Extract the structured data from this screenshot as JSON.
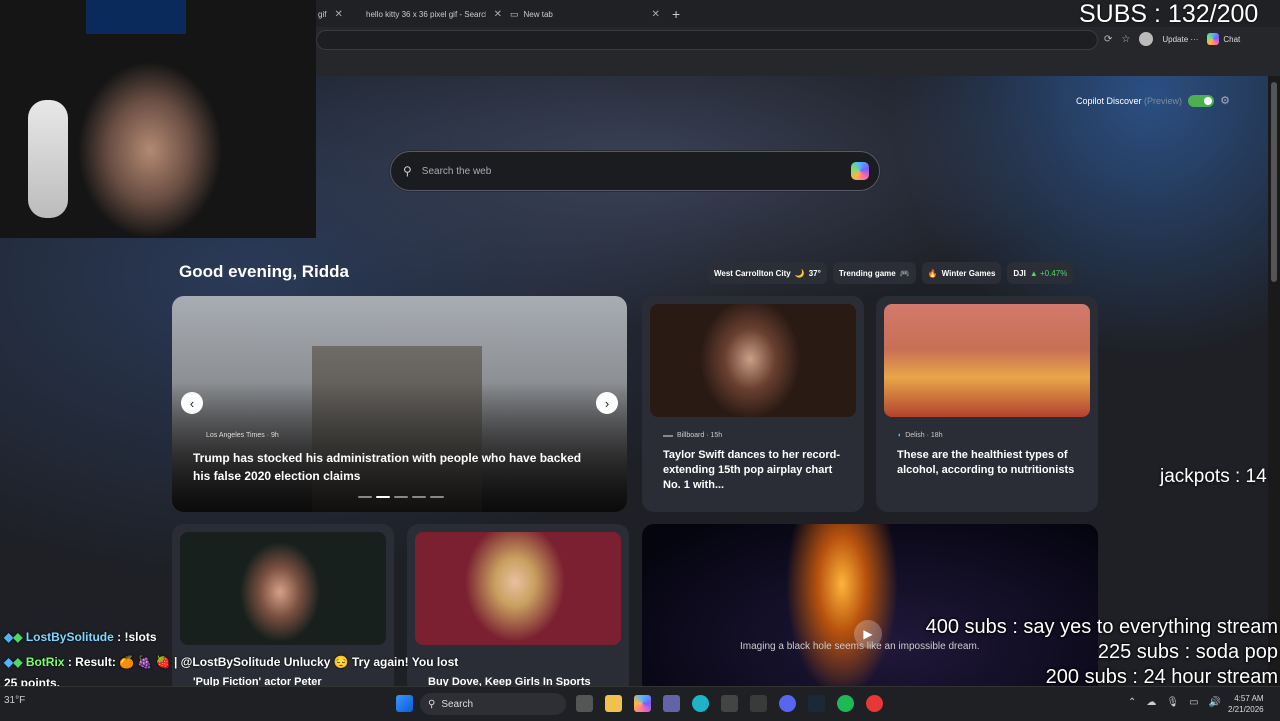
{
  "browser": {
    "tabs": [
      {
        "label": "gif",
        "active": false
      },
      {
        "label": "hello kitty 36 x 36 pixel gif - Search",
        "active": false
      },
      {
        "label": "New tab",
        "active": true
      }
    ],
    "update_label": "Update",
    "chat_label": "Chat"
  },
  "newtab": {
    "copilot_discover_label": "Copilot Discover",
    "preview_label": "(Preview)",
    "search_placeholder": "Search the web",
    "greeting": "Good evening, Ridda",
    "pills": [
      {
        "label": "West Carrollton City",
        "extra": "37°"
      },
      {
        "label": "Trending game",
        "extra": ""
      },
      {
        "label": "Winter Games",
        "extra": ""
      },
      {
        "label": "DJI",
        "extra": "▲ +0.47%"
      }
    ],
    "hero": {
      "source": "Los Angeles Times · 9h",
      "headline": "Trump has stocked his administration with people who have backed his false 2020 election claims"
    },
    "cards": [
      {
        "source": "Billboard · 15h",
        "headline": "Taylor Swift dances to her record-extending 15th pop airplay chart No. 1 with..."
      },
      {
        "source": "Delish · 18h",
        "headline": "These are the healthiest types of alcohol, according to nutritionists"
      }
    ],
    "bottom_cards": [
      {
        "headline": "'Pulp Fiction' actor Peter"
      },
      {
        "headline": "Buy Dove, Keep Girls In Sports"
      }
    ],
    "video_caption": "Imaging a black hole seems like an impossible dream."
  },
  "overlay": {
    "subs_counter": "SUBS : 132/200",
    "jackpots": "jackpots : 14",
    "goals": [
      "400 subs :  say yes to everything stream",
      "225 subs : soda pop",
      "200 subs : 24 hour stream"
    ],
    "chat": [
      {
        "user": "LostBySolitude",
        "message": " : !slots"
      },
      {
        "user": "BotRix",
        "message": " : Result: 🍊 🍇 🍓 | @LostBySolitude Unlucky 😔 Try again! You lost"
      },
      {
        "user": "",
        "message": "25 points."
      }
    ]
  },
  "taskbar": {
    "weather": "31°F",
    "search_label": "Search",
    "time": "4:57 AM",
    "date": "2/21/2026"
  },
  "colors": {
    "accent_green": "#4caf50",
    "chat_user1": "#7fd6ff",
    "chat_user2": "#7dff6a"
  }
}
